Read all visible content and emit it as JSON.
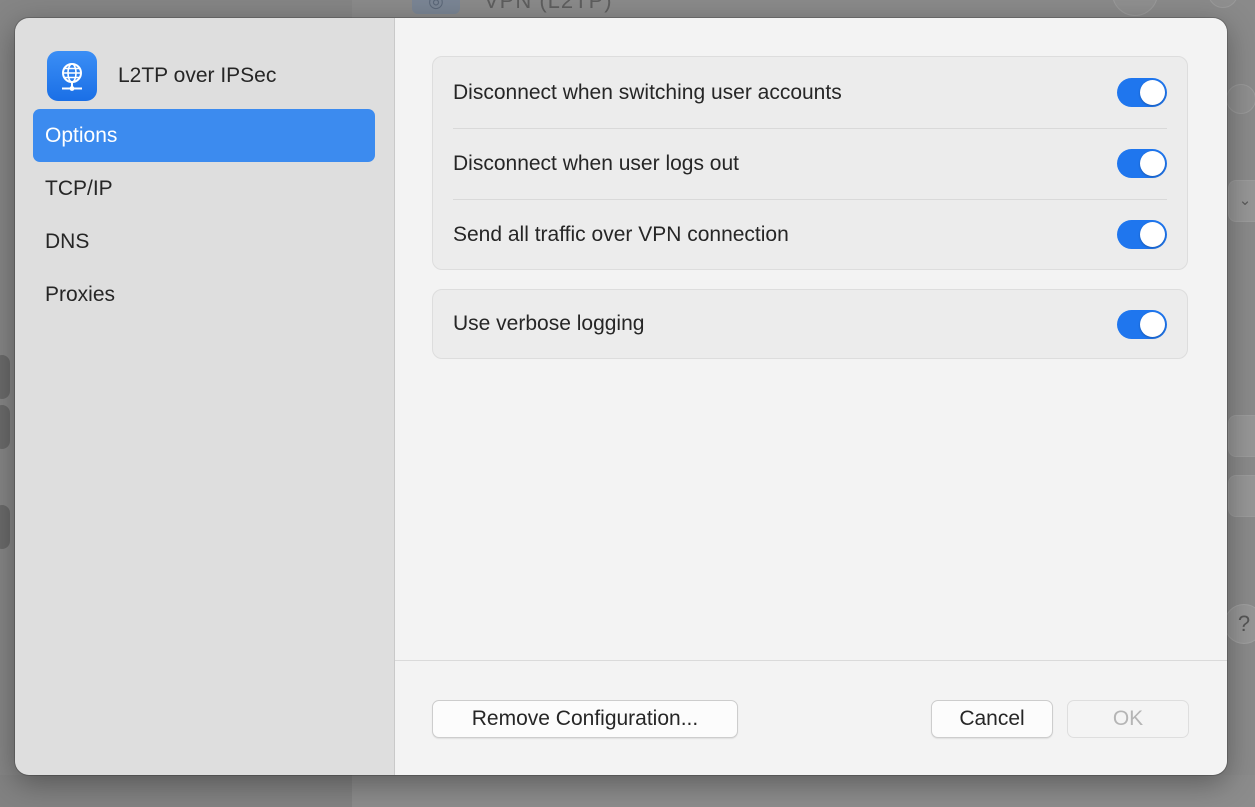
{
  "background_window": {
    "title": "VPN (L2TP)",
    "help_label": "?",
    "chevron": "⌄"
  },
  "sheet": {
    "header": {
      "title": "L2TP over IPSec",
      "icon": "globe-network-icon"
    },
    "sidebar": {
      "items": [
        {
          "label": "Options",
          "selected": true
        },
        {
          "label": "TCP/IP",
          "selected": false
        },
        {
          "label": "DNS",
          "selected": false
        },
        {
          "label": "Proxies",
          "selected": false
        }
      ]
    },
    "options": {
      "group1": [
        {
          "label": "Disconnect when switching user accounts",
          "enabled": true
        },
        {
          "label": "Disconnect when user logs out",
          "enabled": true
        },
        {
          "label": "Send all traffic over VPN connection",
          "enabled": true
        }
      ],
      "group2": [
        {
          "label": "Use verbose logging",
          "enabled": true
        }
      ]
    },
    "footer": {
      "remove_label": "Remove Configuration...",
      "cancel_label": "Cancel",
      "ok_label": "OK",
      "ok_enabled": false
    }
  },
  "colors": {
    "accent": "#1f76ee",
    "selection": "#3c8bef",
    "sidebar_bg": "#dedede",
    "content_bg": "#f3f3f3"
  }
}
